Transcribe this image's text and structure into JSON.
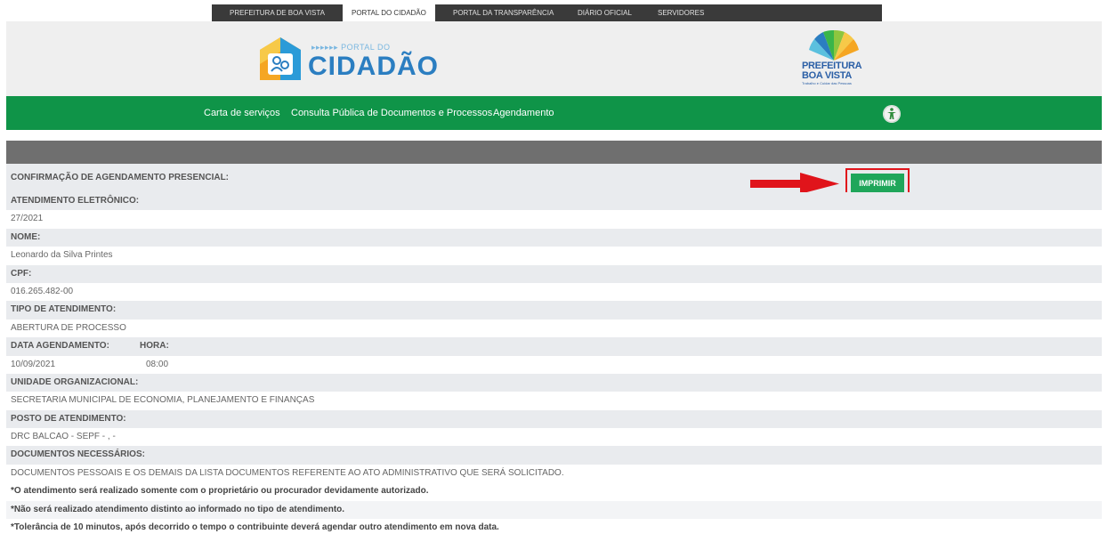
{
  "topnav": {
    "items": [
      {
        "label": "PREFEITURA DE BOA VISTA"
      },
      {
        "label": "PORTAL DO CIDADÃO"
      },
      {
        "label": "PORTAL DA TRANSPARÊNCIA"
      },
      {
        "label": "DIÁRIO OFICIAL"
      },
      {
        "label": "SERVIDORES"
      }
    ]
  },
  "header": {
    "portal_logo_small": "▸▸▸▸▸▸ PORTAL DO",
    "portal_logo_big": "CIDADÃO",
    "prefeitura_line1": "PREFEITURA",
    "prefeitura_line2": "BOA VISTA",
    "prefeitura_tagline": "Trabalho e Cuidar das Pessoas"
  },
  "greennav": {
    "items": [
      {
        "label": "Carta de serviços"
      },
      {
        "label": "Consulta Pública de Documentos e Processos"
      },
      {
        "label": "Agendamento"
      }
    ],
    "accessibility_icon": "accessibility-icon"
  },
  "confirmation": {
    "title": "CONFIRMAÇÃO DE AGENDAMENTO PRESENCIAL:",
    "print_label": "IMPRIMIR",
    "fields": {
      "atendimento_label": "ATENDIMENTO ELETRÔNICO:",
      "atendimento_value": "27/2021",
      "nome_label": "NOME:",
      "nome_value": "Leonardo da Silva Printes",
      "cpf_label": "CPF:",
      "cpf_value": "016.265.482-00",
      "tipo_label": "TIPO DE ATENDIMENTO:",
      "tipo_value": "ABERTURA DE PROCESSO",
      "data_label": "DATA AGENDAMENTO:",
      "hora_label": "HORA:",
      "data_value": "10/09/2021",
      "hora_value": "08:00",
      "unidade_label": "UNIDADE ORGANIZACIONAL:",
      "unidade_value": "SECRETARIA MUNICIPAL DE ECONOMIA, PLANEJAMENTO E FINANÇAS",
      "posto_label": "POSTO DE ATENDIMENTO:",
      "posto_value": "DRC BALCAO - SEPF - , -",
      "docs_label": "DOCUMENTOS NECESSÁRIOS:",
      "docs_value": "DOCUMENTOS PESSOAIS E OS DEMAIS DA LISTA DOCUMENTOS REFERENTE AO ATO ADMINISTRATIVO QUE SERÁ SOLICITADO."
    },
    "notes": [
      "*O atendimento será realizado somente com o proprietário ou procurador devidamente autorizado.",
      "*Não será realizado atendimento distinto ao informado no tipo de atendimento.",
      "*Tolerância de 10 minutos, após decorrido o tempo o contribuinte deverá agendar outro atendimento em nova data."
    ]
  },
  "colors": {
    "green_nav": "#0f9448",
    "print_button": "#1fa65a",
    "highlight_red": "#e0141b",
    "gray_bar": "#6f6f6f"
  }
}
